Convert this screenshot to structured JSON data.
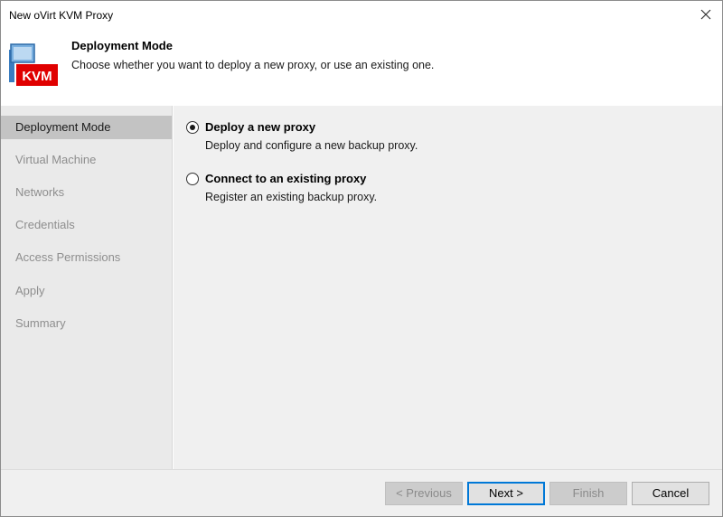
{
  "window": {
    "title": "New oVirt KVM Proxy"
  },
  "header": {
    "title": "Deployment Mode",
    "subtitle": "Choose whether you want to deploy a new proxy, or use an existing one.",
    "logo_badge": "KVM"
  },
  "steps": [
    {
      "label": "Deployment Mode",
      "active": true
    },
    {
      "label": "Virtual Machine",
      "active": false
    },
    {
      "label": "Networks",
      "active": false
    },
    {
      "label": "Credentials",
      "active": false
    },
    {
      "label": "Access Permissions",
      "active": false
    },
    {
      "label": "Apply",
      "active": false
    },
    {
      "label": "Summary",
      "active": false
    }
  ],
  "options": [
    {
      "label": "Deploy a new proxy",
      "description": "Deploy and configure a new backup proxy.",
      "selected": true
    },
    {
      "label": "Connect to an existing proxy",
      "description": "Register an existing backup proxy.",
      "selected": false
    }
  ],
  "buttons": {
    "previous": "< Previous",
    "next": "Next >",
    "finish": "Finish",
    "cancel": "Cancel"
  },
  "colors": {
    "accent": "#0078d7",
    "kvm_badge": "#e00000",
    "sidebar_bg": "#eaeaea",
    "sidebar_active": "#c3c3c3"
  }
}
